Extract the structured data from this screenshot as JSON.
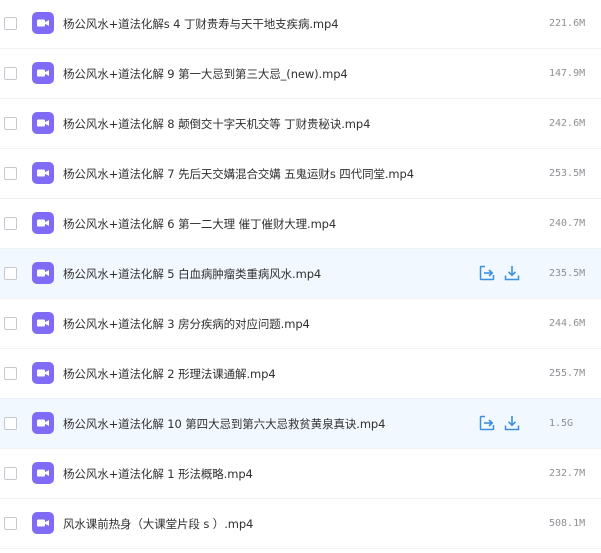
{
  "colors": {
    "video_icon": "#7f6bf6",
    "action_icon": "#3b8fe0",
    "hover_row": "#f2f8ff"
  },
  "files": [
    {
      "name": "杨公风水+道法化解s 4 丁财贵寿与天干地支疾病.mp4",
      "size": "221.6M",
      "icon": "video-file-icon",
      "hovered": false
    },
    {
      "name": "杨公风水+道法化解 9 第一大忌到第三大忌_(new).mp4",
      "size": "147.9M",
      "icon": "video-file-icon",
      "hovered": false
    },
    {
      "name": "杨公风水+道法化解 8 颠倒交十字天机交等 丁财贵秘诀.mp4",
      "size": "242.6M",
      "icon": "video-file-icon",
      "hovered": false
    },
    {
      "name": "杨公风水+道法化解 7 先后天交媾混合交媾 五鬼运财s 四代同堂.mp4",
      "size": "253.5M",
      "icon": "video-file-icon",
      "hovered": false
    },
    {
      "name": "杨公风水+道法化解 6 第一二大理 催丁催财大理.mp4",
      "size": "240.7M",
      "icon": "video-file-icon",
      "hovered": false
    },
    {
      "name": "杨公风水+道法化解 5 白血病肿瘤类重病风水.mp4",
      "size": "235.5M",
      "icon": "video-file-icon",
      "hovered": true
    },
    {
      "name": "杨公风水+道法化解 3 房分疾病的对应问题.mp4",
      "size": "244.6M",
      "icon": "video-file-icon",
      "hovered": false
    },
    {
      "name": "杨公风水+道法化解 2 形理法课通解.mp4",
      "size": "255.7M",
      "icon": "video-file-icon",
      "hovered": false
    },
    {
      "name": "杨公风水+道法化解 10 第四大忌到第六大忌救贫黄泉真诀.mp4",
      "size": "1.5G",
      "icon": "video-file-icon",
      "hovered": true
    },
    {
      "name": "杨公风水+道法化解 1 形法概略.mp4",
      "size": "232.7M",
      "icon": "video-file-icon",
      "hovered": false
    },
    {
      "name": "风水课前热身（大课堂片段 s ）.mp4",
      "size": "508.1M",
      "icon": "video-file-icon",
      "hovered": false
    }
  ]
}
